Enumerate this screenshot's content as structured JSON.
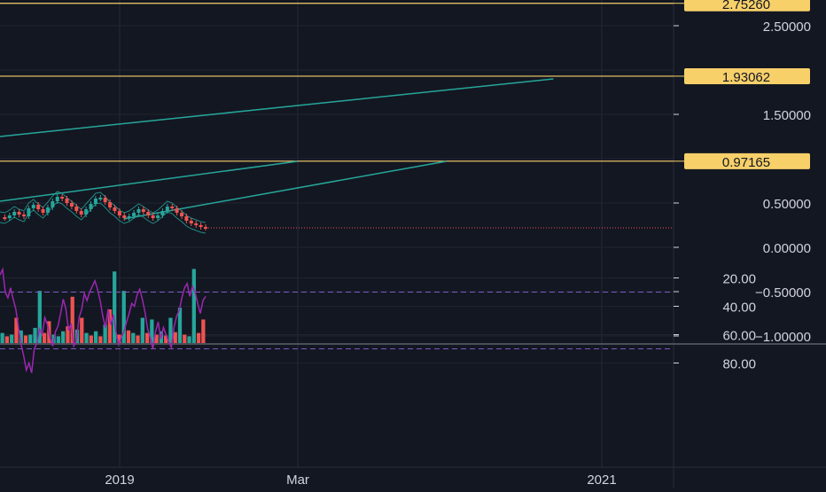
{
  "chart_data": [
    {
      "type": "line",
      "title": "",
      "panel": "price",
      "y_ticks": [
        2.5,
        1.5,
        0.5,
        0.0,
        -0.5,
        -1.0
      ],
      "y_tick_labels": [
        "2.50000",
        "1.50000",
        "0.50000",
        "0.00000",
        "−0.50000",
        "−1.00000"
      ],
      "ylim": [
        -1.05,
        2.78
      ],
      "horizontal_levels": [
        {
          "label": "2.75260",
          "value": 2.7526
        },
        {
          "label": "1.93062",
          "value": 1.93062
        },
        {
          "label": "0.97165",
          "value": 0.97165
        }
      ],
      "trend_lines": [
        {
          "from": [
            0.0,
            1.25
          ],
          "to": [
            0.67,
            1.9
          ]
        },
        {
          "from": [
            0.0,
            0.52
          ],
          "to": [
            0.36,
            0.97
          ]
        },
        {
          "from": [
            0.15,
            0.32
          ],
          "to": [
            0.54,
            0.97
          ]
        }
      ],
      "last_price": 0.22,
      "price_series": [
        0.34,
        0.33,
        0.36,
        0.4,
        0.37,
        0.35,
        0.44,
        0.48,
        0.43,
        0.39,
        0.45,
        0.52,
        0.57,
        0.55,
        0.5,
        0.46,
        0.41,
        0.37,
        0.43,
        0.49,
        0.55,
        0.56,
        0.51,
        0.45,
        0.41,
        0.36,
        0.33,
        0.35,
        0.39,
        0.43,
        0.4,
        0.36,
        0.33,
        0.36,
        0.41,
        0.46,
        0.44,
        0.39,
        0.35,
        0.3,
        0.27,
        0.25,
        0.23,
        0.22
      ],
      "volume_series": [
        {
          "v": 0.12,
          "c": "up"
        },
        {
          "v": 0.08,
          "c": "down"
        },
        {
          "v": 0.1,
          "c": "up"
        },
        {
          "v": 0.3,
          "c": "down"
        },
        {
          "v": 0.15,
          "c": "up"
        },
        {
          "v": 0.09,
          "c": "down"
        },
        {
          "v": 0.1,
          "c": "up"
        },
        {
          "v": 0.18,
          "c": "up"
        },
        {
          "v": 0.62,
          "c": "up"
        },
        {
          "v": 0.12,
          "c": "down"
        },
        {
          "v": 0.26,
          "c": "down"
        },
        {
          "v": 0.1,
          "c": "up"
        },
        {
          "v": 0.08,
          "c": "up"
        },
        {
          "v": 0.14,
          "c": "up"
        },
        {
          "v": 0.2,
          "c": "down"
        },
        {
          "v": 0.55,
          "c": "down"
        },
        {
          "v": 0.16,
          "c": "up"
        },
        {
          "v": 0.3,
          "c": "down"
        },
        {
          "v": 0.12,
          "c": "up"
        },
        {
          "v": 0.09,
          "c": "down"
        },
        {
          "v": 0.14,
          "c": "up"
        },
        {
          "v": 0.08,
          "c": "down"
        },
        {
          "v": 0.22,
          "c": "up"
        },
        {
          "v": 0.4,
          "c": "down"
        },
        {
          "v": 0.85,
          "c": "up"
        },
        {
          "v": 0.1,
          "c": "down"
        },
        {
          "v": 0.62,
          "c": "up"
        },
        {
          "v": 0.15,
          "c": "down"
        },
        {
          "v": 0.12,
          "c": "up"
        },
        {
          "v": 0.09,
          "c": "down"
        },
        {
          "v": 0.3,
          "c": "up"
        },
        {
          "v": 0.12,
          "c": "down"
        },
        {
          "v": 0.28,
          "c": "up"
        },
        {
          "v": 0.1,
          "c": "down"
        },
        {
          "v": 0.14,
          "c": "up"
        },
        {
          "v": 0.09,
          "c": "down"
        },
        {
          "v": 0.3,
          "c": "up"
        },
        {
          "v": 0.13,
          "c": "down"
        },
        {
          "v": 0.42,
          "c": "up"
        },
        {
          "v": 0.1,
          "c": "down"
        },
        {
          "v": 0.08,
          "c": "up"
        },
        {
          "v": 0.88,
          "c": "up"
        },
        {
          "v": 0.12,
          "c": "down"
        },
        {
          "v": 0.28,
          "c": "down"
        }
      ]
    },
    {
      "type": "line",
      "title": "",
      "panel": "oscillator",
      "y_ticks": [
        80,
        60,
        40,
        20
      ],
      "y_tick_labels": [
        "80.00",
        "60.00",
        "40.00",
        "20.00"
      ],
      "ylim": [
        10,
        90
      ],
      "band": [
        30,
        70
      ],
      "series_values": [
        18,
        14,
        30,
        34,
        27,
        35,
        42,
        55,
        67,
        75,
        85,
        80,
        87,
        70,
        66,
        56,
        60,
        48,
        53,
        62,
        68,
        58,
        54,
        45,
        35,
        42,
        57,
        52,
        68,
        64,
        48,
        42,
        31,
        36,
        30,
        26,
        22,
        28,
        36,
        47,
        55,
        42,
        53,
        46,
        58,
        67,
        62,
        58,
        51,
        45,
        38,
        40,
        32,
        28,
        35,
        44,
        56,
        62,
        70,
        58,
        51,
        63,
        55,
        60,
        65,
        69,
        55,
        47,
        43,
        34,
        27,
        24,
        33,
        26,
        30,
        38,
        45,
        36,
        33
      ]
    }
  ],
  "x_axis": {
    "labels": [
      "2019",
      "Mar",
      "2021"
    ]
  },
  "colors": {
    "background": "#131722",
    "grid": "#1f2430",
    "level_line": "#f7d06a",
    "level_label_bg": "#f7d06a",
    "trend": "#26a69a",
    "up": "#26a69a",
    "down": "#ef5350",
    "rsi_line": "#9c27b0",
    "rsi_band": "#2a1c3e",
    "axis_text": "#d1d4dc",
    "separator": "#5d606b"
  }
}
